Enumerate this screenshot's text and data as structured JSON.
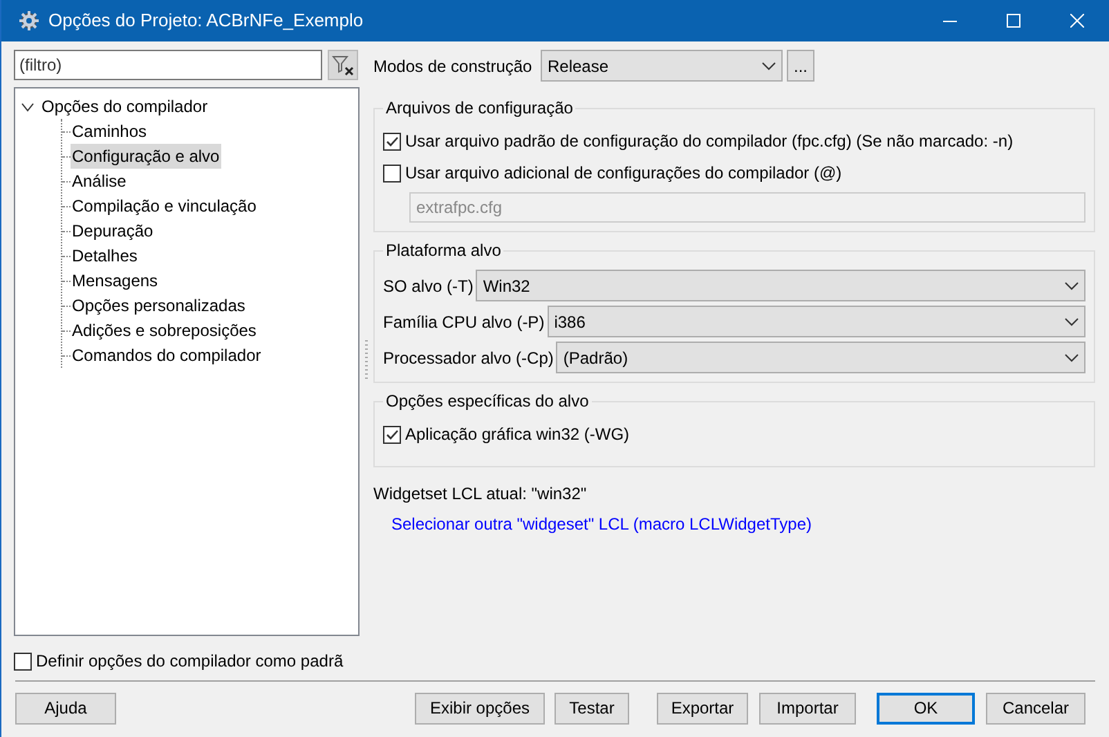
{
  "window": {
    "title": "Opções do Projeto: ACBrNFe_Exemplo"
  },
  "filter": {
    "placeholder": "(filtro)"
  },
  "tree": {
    "label": "Opções do compilador",
    "expanded": true,
    "children": [
      {
        "label": "Caminhos",
        "selected": false
      },
      {
        "label": "Configuração e alvo",
        "selected": true
      },
      {
        "label": "Análise",
        "selected": false
      },
      {
        "label": "Compilação e vinculação",
        "selected": false
      },
      {
        "label": "Depuração",
        "selected": false
      },
      {
        "label": "Detalhes",
        "selected": false
      },
      {
        "label": "Mensagens",
        "selected": false
      },
      {
        "label": "Opções personalizadas",
        "selected": false
      },
      {
        "label": "Adições e sobreposições",
        "selected": false
      },
      {
        "label": "Comandos do compilador",
        "selected": false
      }
    ]
  },
  "default_option": {
    "label": "Definir opções do compilador como padrã",
    "checked": false
  },
  "build_modes": {
    "label": "Modos de construção",
    "value": "Release",
    "button": "..."
  },
  "config_files": {
    "title": "Arquivos de configuração",
    "options": [
      {
        "label": "Usar arquivo padrão de configuração do compilador (fpc.cfg) (Se não marcado: -n)",
        "checked": true
      },
      {
        "label": "Usar arquivo adicional de configurações do compilador (@)",
        "checked": false
      }
    ],
    "extra_file": {
      "value": "extrafpc.cfg",
      "disabled": true
    }
  },
  "target_platform": {
    "title": "Plataforma alvo",
    "fields": [
      {
        "label": "SO alvo (-T)",
        "value": "Win32"
      },
      {
        "label": "Família CPU alvo (-P)",
        "value": "i386"
      },
      {
        "label": "Processador alvo (-Cp)",
        "value": "(Padrão)"
      }
    ]
  },
  "target_options": {
    "title": "Opções específicas do alvo",
    "options": [
      {
        "label": "Aplicação gráfica win32 (-WG)",
        "checked": true
      }
    ]
  },
  "widgetset": {
    "text": "Widgetset LCL atual: \"win32\"",
    "link": "Selecionar outra \"widgeset\" LCL (macro LCLWidgetType)"
  },
  "buttons": [
    {
      "label": "Ajuda",
      "default": false
    },
    {
      "label": "Exibir opções",
      "default": false
    },
    {
      "label": "Testar",
      "default": false
    },
    {
      "label": "Exportar",
      "default": false
    },
    {
      "label": "Importar",
      "default": false
    },
    {
      "label": "OK",
      "default": true
    },
    {
      "label": "Cancelar",
      "default": false
    }
  ]
}
